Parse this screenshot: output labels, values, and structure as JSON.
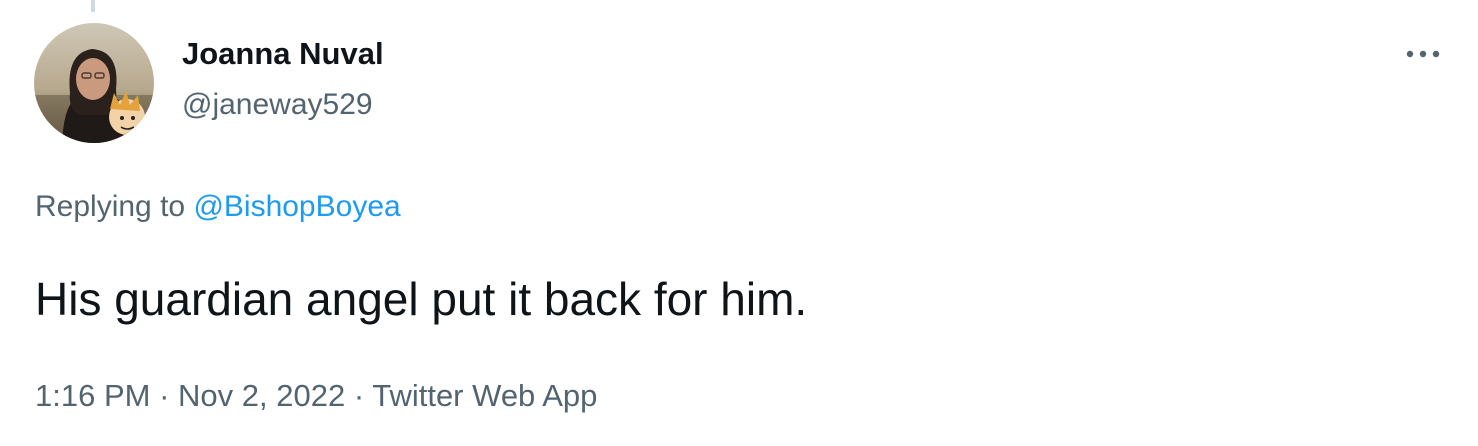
{
  "tweet": {
    "author": {
      "name": "Joanna Nuval",
      "handle": "@janeway529"
    },
    "replying_prefix": "Replying to",
    "replying_to": "@BishopBoyea",
    "text": "His guardian angel put it back for him.",
    "time": "1:16 PM",
    "separator": "·",
    "date": "Nov 2, 2022",
    "source": "Twitter Web App"
  },
  "icons": {
    "more": "more-horizontal-icon",
    "avatar": "profile-photo"
  },
  "colors": {
    "text_primary": "#0f1419",
    "text_secondary": "#536471",
    "link": "#1d9bf0",
    "thread_line": "#cfd9de"
  }
}
